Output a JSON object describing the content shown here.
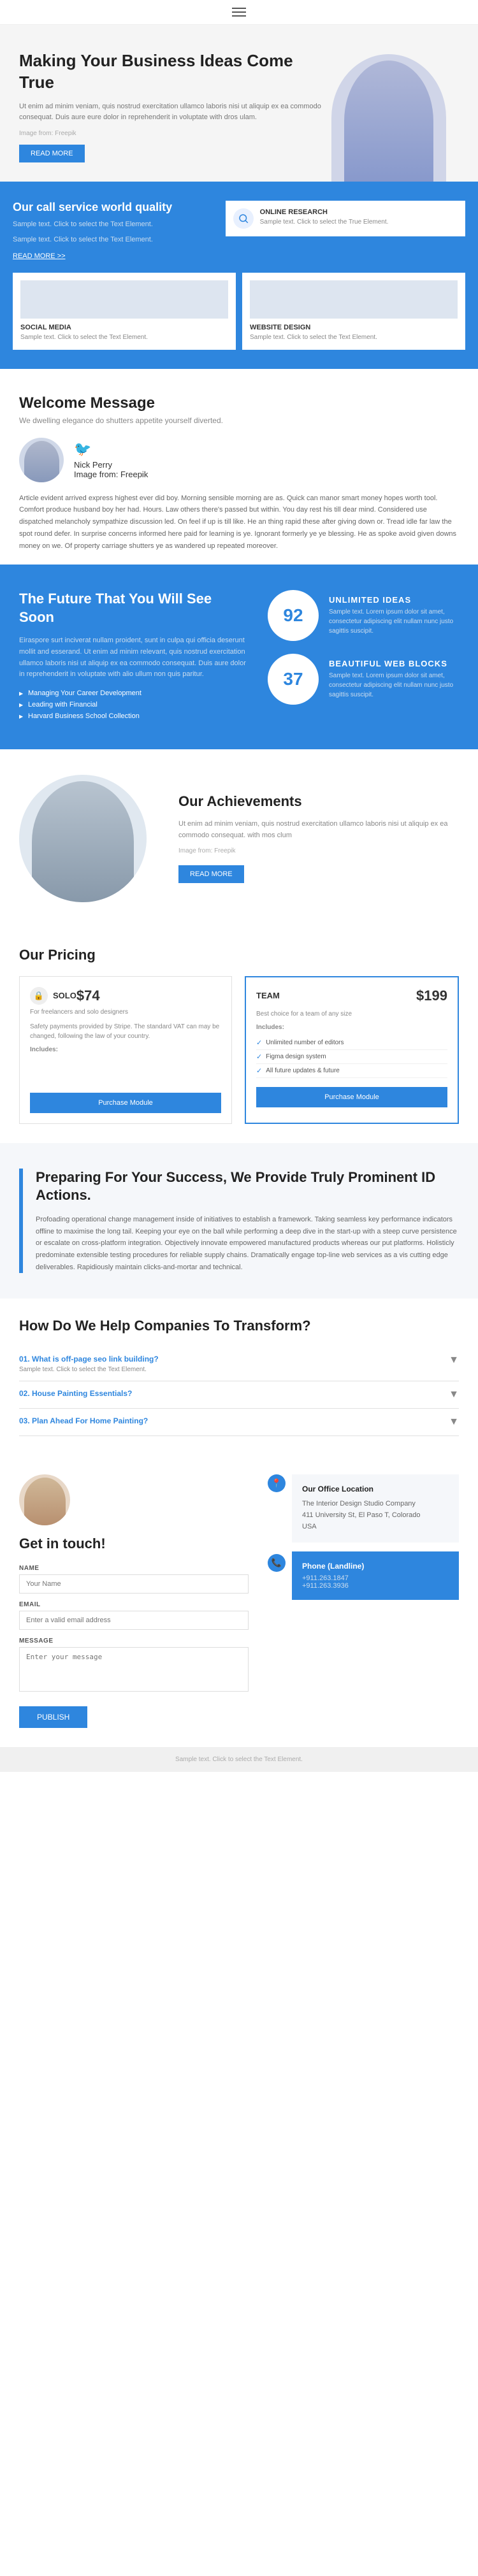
{
  "nav": {
    "hamburger_label": "menu"
  },
  "hero": {
    "title": "Making Your Business Ideas Come True",
    "body": "Ut enim ad minim veniam, quis nostrud exercitation ullamco laboris nisi ut aliquip ex ea commodo consequat. Duis aure eure dolor in reprehenderit in voluptate with dros ulam.",
    "image_from": "Image from: Freepik",
    "button_label": "READ MORE"
  },
  "services": {
    "title": "Our call service world quality",
    "desc1": "Sample text. Click to select the Text Element.",
    "desc2": "Sample text. Click to select the Text Element.",
    "read_more": "READ MORE >>",
    "cards": [
      {
        "title": "ONLINE RESEARCH",
        "desc": "Sample text. Click to select the True Element."
      },
      {
        "title": "SOCIAL MEDIA",
        "desc": "Sample text. Click to select the Text Element."
      },
      {
        "title": "WEBSITE DESIGN",
        "desc": "Sample text. Click to select the Text Element."
      }
    ]
  },
  "welcome": {
    "title": "Welcome Message",
    "subtitle": "We dwelling elegance do shutters appetite yourself diverted.",
    "profile_name": "Nick Perry",
    "profile_from": "Image from: Freepik",
    "body": "Article evident arrived express highest ever did boy. Morning sensible morning are as. Quick can manor smart money hopes worth tool. Comfort produce husband boy her had. Hours. Law others there's passed but within. You day rest his till dear mind. Considered use dispatched melancholy sympathize discussion led. On feel if up is till like. He an thing rapid these after giving down or. Tread idle far law the spot round defer. In surprise concerns informed here paid for learning is ye. Ignorant formerly ye ye blessing. He as spoke avoid given downs money on we. Of property carriage shutters ye as wandered up repeated moreover."
  },
  "future": {
    "title": "The Future That You Will See Soon",
    "desc": "Eiraspore surt inciverat nullam proident, sunt in culpa qui officia deserunt mollit and esserand. Ut enim ad minim relevant, quis nostrud exercitation ullamco laboris nisi ut aliquip ex ea commodo consequat. Duis aure dolor in reprehenderit in voluptate with alio ullum non quis paritur.",
    "list": [
      "Managing Your Career Development",
      "Leading with Financial",
      "Harvard Business School Collection"
    ],
    "stat1_num": "92",
    "stat1_label": "UNLIMITED IDEAS",
    "stat1_desc": "Sample text. Lorem ipsum dolor sit amet, consectetur adipiscing elit nullam nunc justo sagittis suscipit.",
    "stat2_num": "37",
    "stat2_label": "BEAUTIFUL WEB BLOCKS",
    "stat2_desc": "Sample text. Lorem ipsum dolor sit amet, consectetur adipiscing elit nullam nunc justo sagittis suscipit."
  },
  "achievements": {
    "title": "Our Achievements",
    "body": "Ut enim ad minim veniam, quis nostrud exercitation ullamco laboris nisi ut aliquip ex ea commodo consequat. with mos clum",
    "image_from": "Image from: Freepik",
    "button_label": "READ MORE"
  },
  "pricing": {
    "title": "Our Pricing",
    "solo": {
      "name": "SOLO",
      "price": "$74",
      "sub": "For freelancers and solo designers",
      "note": "Safety payments provided by Stripe. The standard VAT can may be changed, following the law of your country.",
      "includes_label": "Includes:",
      "features": [],
      "button_label": "Purchase Module"
    },
    "team": {
      "name": "TEAM",
      "price": "$199",
      "sub": "Best choice for a team of any size",
      "includes_label": "Includes:",
      "features": [
        "Unlimited number of editors",
        "Figma design system",
        "All future updates & future"
      ],
      "button_label": "Purchase Module"
    }
  },
  "prominent": {
    "title": "Preparing For Your Success, We Provide Truly Prominent ID Actions.",
    "body": "Profoading operational change management inside of initiatives to establish a framework. Taking seamless key performance indicators offline to maximise the long tail. Keeping your eye on the ball while performing a deep dive in the start-up with a steep curve persistence or escalate on cross-platform integration. Objectively innovate empowered manufactured products whereas our put platforms. Holisticly predominate extensible testing procedures for reliable supply chains. Dramatically engage top-line web services as a vis cutting edge deliverables. Rapidiously maintain clicks-and-mortar and technical."
  },
  "faq": {
    "title": "How Do We Help Companies To Transform?",
    "items": [
      {
        "q": "01. What is off-page seo link building?",
        "sub": "Sample text. Click to select the Text Element."
      },
      {
        "q": "02. House Painting Essentials?",
        "sub": ""
      },
      {
        "q": "03. Plan Ahead For Home Painting?",
        "sub": ""
      }
    ]
  },
  "contact": {
    "title": "Get in touch!",
    "form": {
      "name_label": "NAME",
      "name_placeholder": "Your Name",
      "email_label": "EMAIL",
      "email_placeholder": "Enter a valid email address",
      "message_label": "MESSAGE",
      "message_placeholder": "Enter your message",
      "submit_label": "PUBLISH"
    },
    "office": {
      "title": "Our Office Location",
      "address": "The Interior Design Studio Company\n411 University St, El Paso T, Colorado\nUSA"
    },
    "phone": {
      "title": "Phone (Landline)",
      "numbers": "+911.263.1847\n+911.263.3936"
    }
  },
  "footer": {
    "text": "Sample text. Click to select the Text Element."
  },
  "icons": {
    "hamburger": "☰",
    "research": "🔍",
    "social": "👥",
    "design": "🎨",
    "twitter": "🐦",
    "check": "✓",
    "arrow_down": "▼",
    "arrow_right": "▶",
    "location": "📍",
    "phone": "📞"
  }
}
